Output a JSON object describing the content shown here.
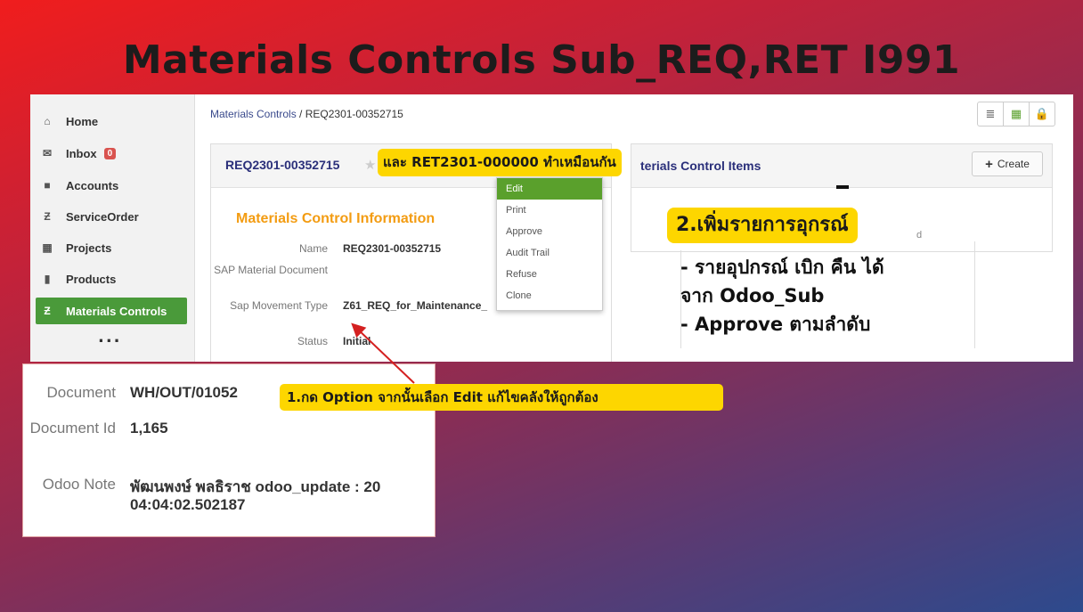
{
  "slide": {
    "title": "Materials Controls Sub_REQ,RET I991"
  },
  "sidebar": {
    "items": [
      {
        "label": "Home",
        "icon": "home-icon"
      },
      {
        "label": "Inbox",
        "icon": "envelope-icon",
        "badge": "0"
      },
      {
        "label": "Accounts",
        "icon": "folder-icon"
      },
      {
        "label": "ServiceOrder",
        "icon": "z-icon"
      },
      {
        "label": "Projects",
        "icon": "briefcase-icon"
      },
      {
        "label": "Products",
        "icon": "box-icon"
      },
      {
        "label": "Materials Controls",
        "icon": "z-icon",
        "active": true
      }
    ],
    "more": "..."
  },
  "breadcrumb": {
    "parent": "Materials Controls",
    "separator": " / ",
    "current": "REQ2301-00352715"
  },
  "record": {
    "title": "REQ2301-00352715",
    "section_title": "Materials Control Information",
    "fields": [
      {
        "label": "Name",
        "value": "REQ2301-00352715"
      },
      {
        "label": "SAP Material Document",
        "value": ""
      },
      {
        "label": "Sap Movement Type",
        "value": "Z61_REQ_for_Maintenance_"
      },
      {
        "label": "Status",
        "value": "Initial"
      }
    ]
  },
  "options_menu": [
    "Edit",
    "Print",
    "Approve",
    "Audit Trail",
    "Refuse",
    "Clone"
  ],
  "items_panel": {
    "title": "terials Control Items",
    "create_label": "Create",
    "partial_text": "d"
  },
  "annotations": {
    "same_for_ret": "และ RET2301-000000 ทำเหมือนกัน",
    "step2": "2.เพิ่มรายการอุกรณ์",
    "step1": "1.กด Option จากนั้นเลือก Edit แก้ไขคลังให้ถูกต้อง",
    "bullets": [
      "- รายอุปกรณ์ เบิก คืน ได้",
      "จาก Odoo_Sub",
      "- Approve ตามลำดับ"
    ]
  },
  "detail_shot": {
    "fields": [
      {
        "label": "Document",
        "value": "WH/OUT/01052"
      },
      {
        "label": "Document Id",
        "value": "1,165"
      },
      {
        "label": "Odoo Note",
        "value": "พัฒนพงษ์ พลธิราช odoo_update : 20",
        "value2": "04:04:02.502187"
      }
    ]
  },
  "colors": {
    "accent_green": "#5aa02c",
    "highlight_yellow": "#fdd600",
    "section_orange": "#f39c12",
    "title_navy": "#2a2f7a"
  }
}
